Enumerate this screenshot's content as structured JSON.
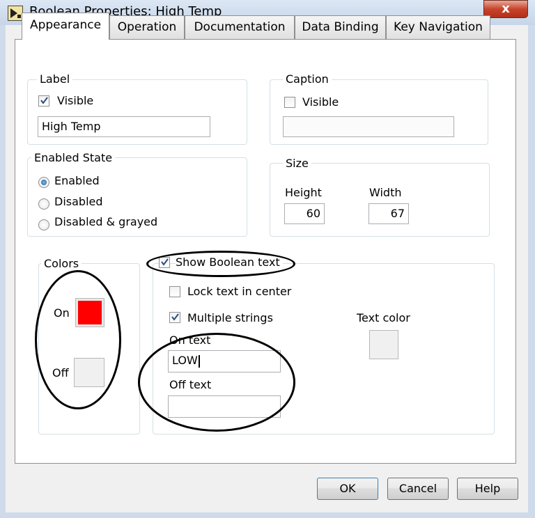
{
  "window": {
    "title": "Boolean Properties: High Temp",
    "close_label": "x"
  },
  "tabs": [
    {
      "label": "Appearance",
      "active": true
    },
    {
      "label": "Operation",
      "active": false
    },
    {
      "label": "Documentation",
      "active": false
    },
    {
      "label": "Data Binding",
      "active": false
    },
    {
      "label": "Key Navigation",
      "active": false
    }
  ],
  "label_group": {
    "title": "Label",
    "visible_label": "Visible",
    "visible_checked": true,
    "value": "High Temp"
  },
  "caption_group": {
    "title": "Caption",
    "visible_label": "Visible",
    "visible_checked": false,
    "value": ""
  },
  "enabled_state": {
    "title": "Enabled State",
    "options": [
      {
        "label": "Enabled",
        "selected": true
      },
      {
        "label": "Disabled",
        "selected": false
      },
      {
        "label": "Disabled & grayed",
        "selected": false
      }
    ]
  },
  "size_group": {
    "title": "Size",
    "height_label": "Height",
    "height_value": "60",
    "width_label": "Width",
    "width_value": "67"
  },
  "colors_group": {
    "title": "Colors",
    "on_label": "On",
    "on_color": "#ff0000",
    "off_label": "Off",
    "off_color": "#f0f0f0"
  },
  "boolean_text": {
    "show_label": "Show Boolean text",
    "show_checked": true,
    "lock_label": "Lock text in center",
    "lock_checked": false,
    "multiple_label": "Multiple strings",
    "multiple_checked": true,
    "text_color_label": "Text color",
    "text_color": "#f0f0f0",
    "on_text_label": "On text",
    "on_text_value": "LOW",
    "off_text_label": "Off text",
    "off_text_value": ""
  },
  "buttons": {
    "ok": "OK",
    "cancel": "Cancel",
    "help": "Help"
  }
}
